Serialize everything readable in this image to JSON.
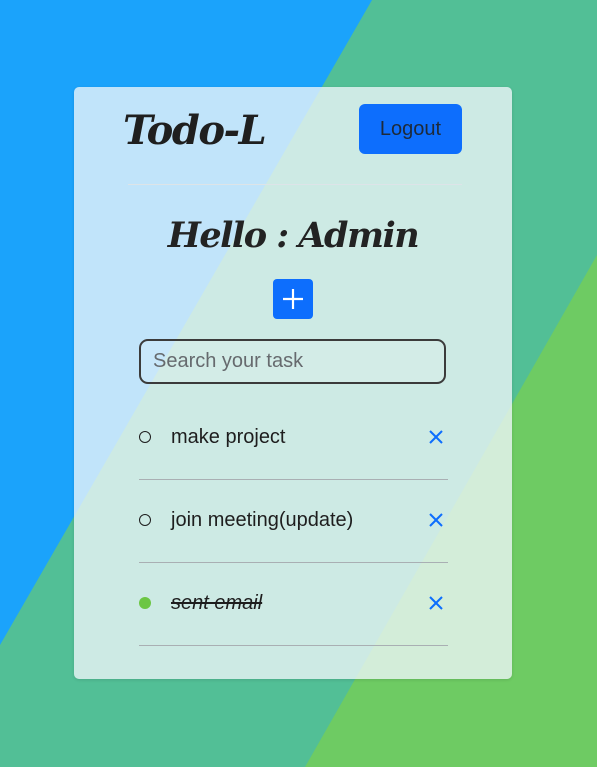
{
  "colors": {
    "background_blue": "#1ba3fb",
    "background_teal": "#52bf96",
    "background_green": "#6ecb63",
    "accent": "#0d6efd",
    "done_dot": "#6cc644"
  },
  "header": {
    "logo": "Todo-L",
    "logout_label": "Logout"
  },
  "greeting": "Hello : Admin",
  "add_button": {
    "icon": "plus-icon"
  },
  "search": {
    "placeholder": "Search your task",
    "value": ""
  },
  "tasks": [
    {
      "text": "make project",
      "completed": false,
      "delete_icon": "close-icon"
    },
    {
      "text": "join meeting(update)",
      "completed": false,
      "delete_icon": "close-icon"
    },
    {
      "text": "sent email",
      "completed": true,
      "delete_icon": "close-icon"
    }
  ]
}
